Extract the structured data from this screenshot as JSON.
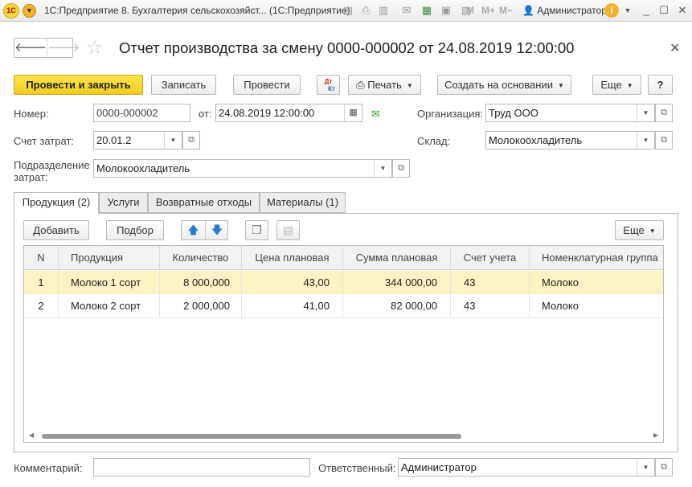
{
  "window": {
    "title": "1С:Предприятие 8. Бухгалтерия сельскохозяйст... (1С:Предприятие)",
    "user": "Администратор",
    "toolbar_m": [
      "M",
      "M+",
      "M−"
    ]
  },
  "document": {
    "title": "Отчет производства за смену 0000-000002 от 24.08.2019 12:00:00"
  },
  "actions": {
    "post_and_close": "Провести и закрыть",
    "save": "Записать",
    "post": "Провести",
    "dt_kt_top": "Дт",
    "dt_kt_bottom": "Кт",
    "print": "Печать",
    "create_based_on": "Создать на основании",
    "more": "Еще",
    "help": "?"
  },
  "form": {
    "number_label": "Номер:",
    "number_value": "0000-000002",
    "date_label": "от:",
    "date_value": "24.08.2019 12:00:00",
    "org_label": "Организация:",
    "org_value": "Труд ООО",
    "cost_account_label": "Счет затрат:",
    "cost_account_value": "20.01.2",
    "warehouse_label": "Склад:",
    "warehouse_value": "Молокоохладитель",
    "division_label_1": "Подразделение",
    "division_label_2": "затрат:",
    "division_value": "Молокоохладитель",
    "comment_label": "Комментарий:",
    "comment_value": "",
    "responsible_label": "Ответственный:",
    "responsible_value": "Администратор"
  },
  "tabs": [
    {
      "label": "Продукция (2)"
    },
    {
      "label": "Услуги"
    },
    {
      "label": "Возвратные отходы"
    },
    {
      "label": "Материалы (1)"
    }
  ],
  "table_toolbar": {
    "add": "Добавить",
    "select": "Подбор",
    "more": "Еще"
  },
  "table": {
    "columns": [
      "N",
      "Продукция",
      "Количество",
      "Цена плановая",
      "Сумма плановая",
      "Счет учета",
      "Номенклатурная группа"
    ],
    "rows": [
      {
        "n": "1",
        "product": "Молоко 1 сорт",
        "qty": "8 000,000",
        "price": "43,00",
        "sum": "344 000,00",
        "account": "43",
        "group": "Молоко"
      },
      {
        "n": "2",
        "product": "Молоко 2 сорт",
        "qty": "2 000,000",
        "price": "41,00",
        "sum": "82 000,00",
        "account": "43",
        "group": "Молоко"
      }
    ]
  },
  "colors": {
    "primary_button": "#f4cc20",
    "selected_row": "#fbf3c4"
  }
}
